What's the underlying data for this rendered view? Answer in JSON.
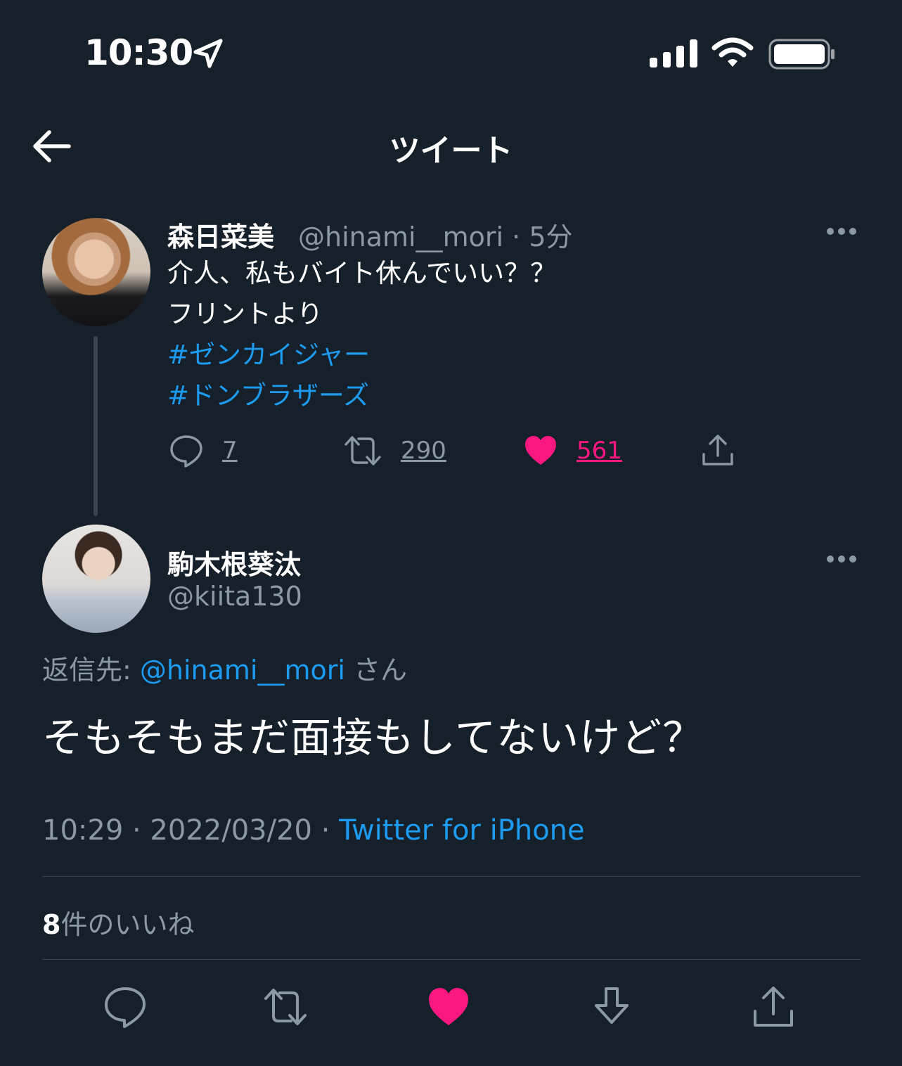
{
  "status_bar": {
    "time": "10:30",
    "icons": [
      "location-arrow-icon",
      "cellular-signal-icon",
      "wifi-icon",
      "battery-icon"
    ]
  },
  "header": {
    "title": "ツイート",
    "back_icon": "arrow-left-icon"
  },
  "tweet_parent": {
    "display_name": "森日菜美",
    "handle": "@hinami__mori",
    "time_ago": "5分",
    "text_lines": [
      "介人、私もバイト休んでいい？？",
      "フリントより"
    ],
    "hashtags": [
      "#ゼンカイジャー",
      "#ドンブラザーズ"
    ],
    "actions": {
      "reply_count": "7",
      "retweet_count": "290",
      "like_count": "561"
    }
  },
  "tweet_main": {
    "display_name": "駒木根葵汰",
    "handle": "@kiita130",
    "reply_label": "返信先:",
    "reply_mention": "@hinami__mori",
    "reply_suffix": "さん",
    "text": "そもそもまだ面接もしてないけど？",
    "timestamp": "10:29 · 2022/03/20 ·",
    "source": "Twitter for iPhone",
    "likes_count": "8",
    "likes_label": "件のいいね"
  },
  "colors": {
    "background": "#15202b",
    "link": "#1d9bf0",
    "like": "#f91880",
    "secondary_text": "#8b98a5",
    "divider": "#38444d"
  }
}
